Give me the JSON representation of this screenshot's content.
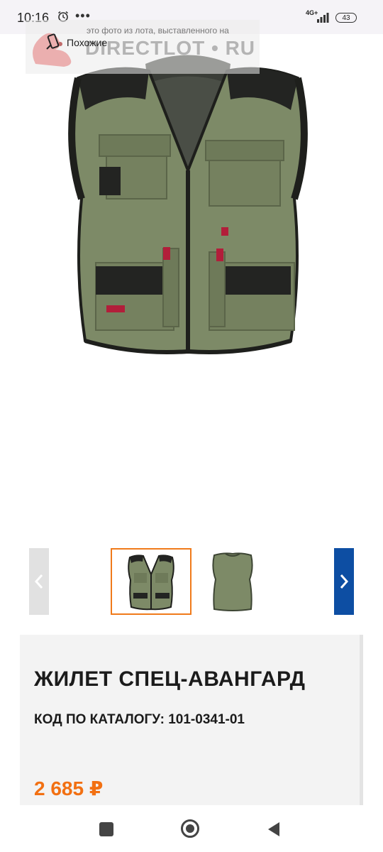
{
  "status_bar": {
    "time": "10:16",
    "more": "•••",
    "network": "4G+",
    "battery": "43"
  },
  "watermark": {
    "caption": "это фото из лота, выставленного на",
    "logo": "DIRECTLOT • RU"
  },
  "similar_button": {
    "label": "Похожие",
    "icon": "image-search-icon"
  },
  "product": {
    "title": "ЖИЛЕТ СПЕЦ-АВАНГАРД",
    "catalog_code": "КОД ПО КАТАЛОГУ: 101-0341-01",
    "price": "2 685 ₽"
  },
  "gallery": {
    "active_index": 0,
    "thumbnails": [
      "vest-front",
      "vest-back"
    ]
  },
  "colors": {
    "accent_orange": "#f27012",
    "nav_blue": "#0d4ea3",
    "vest_green": "#7d8a67"
  }
}
